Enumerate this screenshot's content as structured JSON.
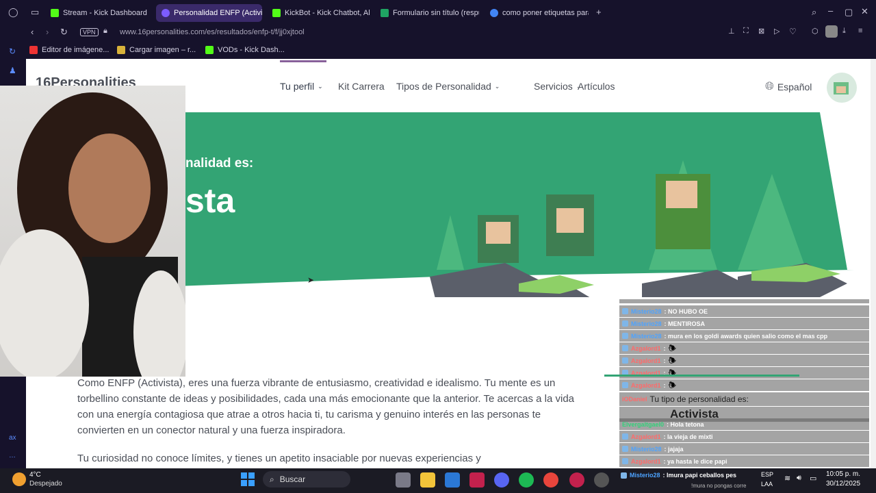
{
  "browser": {
    "tabs": [
      {
        "label": "Stream - Kick Dashboard",
        "color": "#53fc18",
        "active": false
      },
      {
        "label": "Personalidad ENFP (Activi",
        "color": "#7c5cff",
        "active": true
      },
      {
        "label": "KickBot - Kick Chatbot, Al",
        "color": "#53fc18",
        "active": false
      },
      {
        "label": "Formulario sin título (respu",
        "color": "#1fa463",
        "active": false
      },
      {
        "label": "como poner etiquetas para",
        "color": "#4285f4",
        "active": false
      }
    ],
    "new_tab": "+",
    "vpn": "VPN",
    "url": "www.16personalities.com/es/resultados/enfp-t/f/jj0xjtool",
    "bookmarks": [
      "Editor de imágene...",
      "Cargar imagen – r...",
      "VODs - Kick Dash..."
    ]
  },
  "site": {
    "logo": "16Personalities",
    "nav": [
      "Tu perfil",
      "Kit Carrera",
      "Tipos de Personalidad",
      "Servicios",
      "Artículos"
    ],
    "language": "Español",
    "hero_subtitle": "nalidad es:",
    "hero_title": "sta",
    "paragraph1": "Como ENFP (Activista), eres una fuerza vibrante de entusiasmo, creatividad e idealismo. Tu mente es un torbellino constante de ideas y posibilidades, cada una más emocionante que la anterior. Te acercas a la vida con una energía contagiosa que atrae a otros hacia ti, tu carisma y genuino interés en las personas te convierten en un conector natural y una fuerza inspiradora.",
    "paragraph2": "Tu curiosidad no conoce límites, y tienes un apetito insaciable por nuevas experiencias y"
  },
  "chat": {
    "messages": [
      {
        "user": "Misterio28",
        "text": ": NO HUBO OE",
        "color": "blue"
      },
      {
        "user": "Misterio28",
        "text": ": MENTIROSA",
        "color": "blue"
      },
      {
        "user": "Misterio28",
        "text": ": mura en los goldi awards quien salio como el mas cpp",
        "color": "blue"
      },
      {
        "user": "Azgalord1",
        "text": ":",
        "color": "red"
      },
      {
        "user": "Azgalord1",
        "text": ":",
        "color": "red"
      },
      {
        "user": "Azgalord1",
        "text": ":",
        "color": "red"
      },
      {
        "user": "Azgalord1",
        "text": ":",
        "color": "red"
      },
      {
        "user": "iODaniel",
        "text": "Tu tipo de personalidad es:",
        "color": "red"
      },
      {
        "user": "",
        "text": "Activista",
        "color": "red"
      },
      {
        "user": "Elvergaltgael0",
        "text": ": Hola tetona",
        "color": "green"
      },
      {
        "user": "Azgalord1",
        "text": ": la vieja de mixti",
        "color": "red"
      },
      {
        "user": "Misterio28",
        "text": ": jajaja",
        "color": "blue"
      },
      {
        "user": "Azgalord1",
        "text": ": ya hasta le dice papi",
        "color": "red"
      },
      {
        "user": "Misterio28",
        "text": ": Imura papi ceballos pes",
        "color": "blue"
      }
    ],
    "last_line": "!mura no pongas corre"
  },
  "taskbar": {
    "weather_temp": "4°C",
    "weather_desc": "Despejado",
    "search": "Buscar",
    "lang1": "ESP",
    "lang2": "LAA",
    "time": "10:05 p. m.",
    "date": "30/12/2025"
  },
  "colors": {
    "hero": "#33a474",
    "chrome": "#16122b"
  }
}
